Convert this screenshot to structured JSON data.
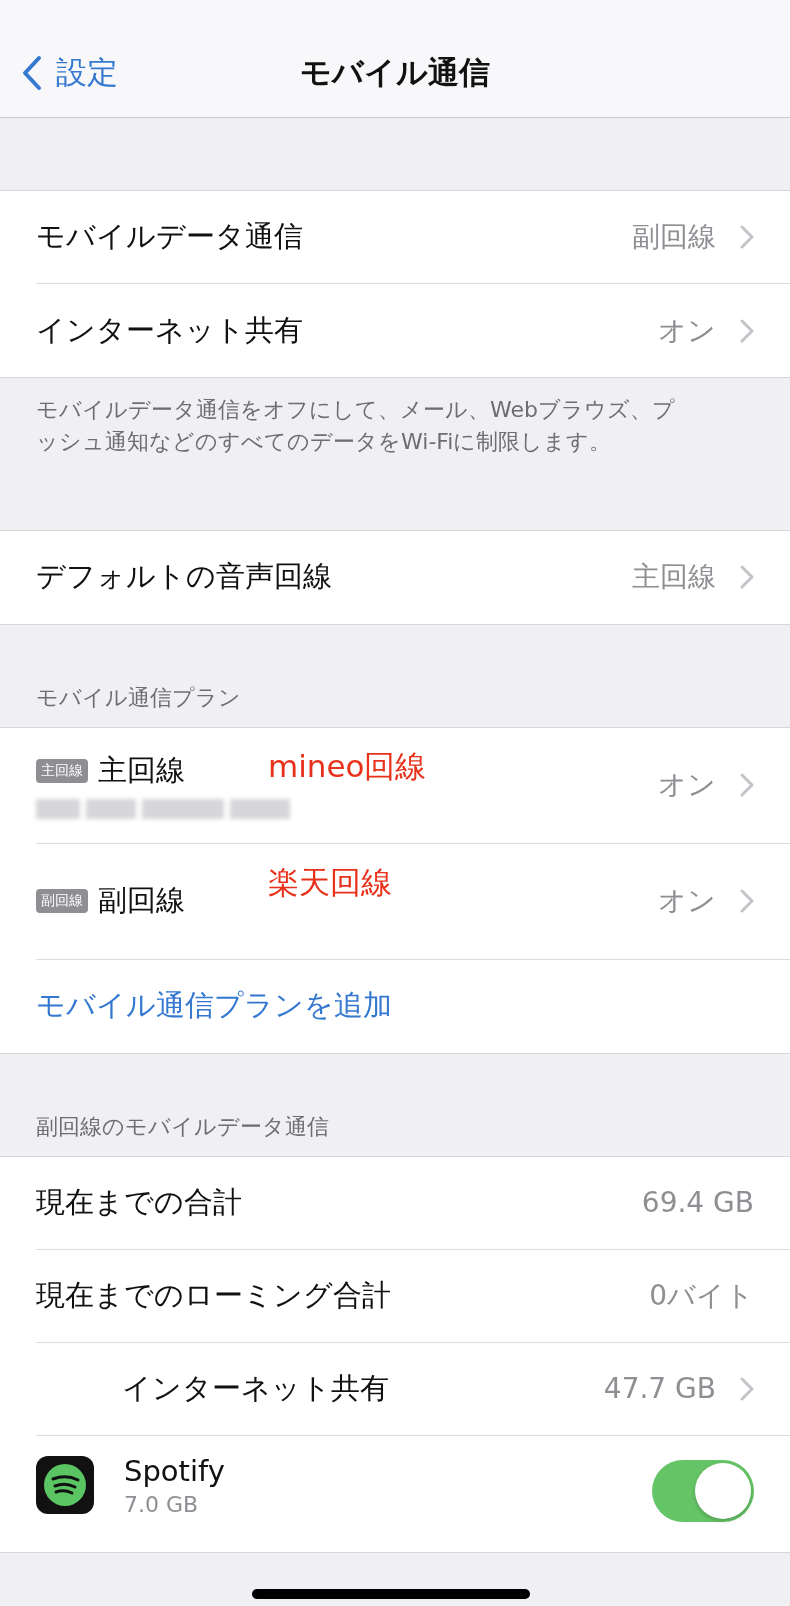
{
  "nav": {
    "back": "設定",
    "title": "モバイル通信"
  },
  "sections": [
    {
      "rows": [
        {
          "kind": "detail",
          "label": "モバイルデータ通信",
          "value": "副回線"
        },
        {
          "kind": "detail",
          "label": "インターネット共有",
          "value": "オン"
        }
      ],
      "footer": "モバイルデータ通信をオフにして、メール、Webブラウズ、プッシュ通知などのすべてのデータをWi-Fiに制限します。"
    },
    {
      "rows": [
        {
          "kind": "detail",
          "label": "デフォルトの音声回線",
          "value": "主回線"
        }
      ]
    },
    {
      "header": "モバイル通信プラン",
      "rows": [
        {
          "kind": "plan",
          "badge": "主回線",
          "label": "主回線",
          "redacted": true,
          "annotation": "mineo回線",
          "value": "オン"
        },
        {
          "kind": "plan",
          "badge": "副回線",
          "label": "副回線",
          "redacted": false,
          "annotation": "楽天回線",
          "value": "オン"
        },
        {
          "kind": "link",
          "label": "モバイル通信プランを追加"
        }
      ]
    },
    {
      "header": "副回線のモバイルデータ通信",
      "rows": [
        {
          "kind": "stat",
          "label": "現在までの合計",
          "value": "69.4 GB"
        },
        {
          "kind": "stat",
          "label": "現在までのローミング合計",
          "value": "0バイト"
        },
        {
          "kind": "sub",
          "label": "インターネット共有",
          "value": "47.7 GB"
        },
        {
          "kind": "app",
          "label": "Spotify",
          "detail": "7.0 GB",
          "on": true
        }
      ]
    }
  ]
}
